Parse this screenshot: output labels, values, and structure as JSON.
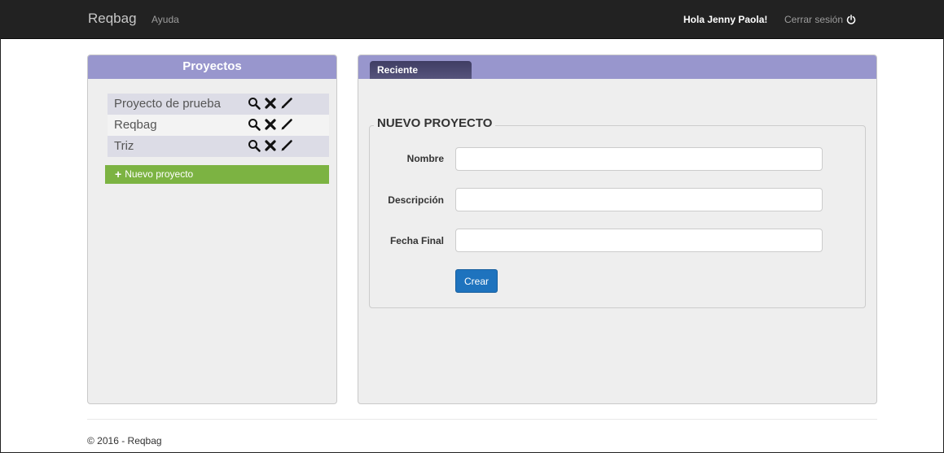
{
  "navbar": {
    "brand": "Reqbag",
    "help": "Ayuda",
    "greeting": "Hola Jenny Paola!",
    "logout": "Cerrar sesión",
    "logout_icon": "power-icon"
  },
  "sidebar": {
    "title": "Proyectos",
    "projects": [
      {
        "name": "Proyecto de prueba",
        "actions": [
          "search-icon",
          "delete-icon",
          "edit-icon"
        ]
      },
      {
        "name": "Reqbag",
        "actions": [
          "search-icon",
          "delete-icon",
          "edit-icon"
        ]
      },
      {
        "name": "Triz",
        "actions": [
          "search-icon",
          "delete-icon",
          "edit-icon"
        ]
      }
    ],
    "new_project": "Nuevo proyecto"
  },
  "main": {
    "tab": "Reciente",
    "form": {
      "legend": "NUEVO PROYECTO",
      "fields": [
        {
          "label": "Nombre",
          "value": ""
        },
        {
          "label": "Descripción",
          "value": ""
        },
        {
          "label": "Fecha Final",
          "value": ""
        }
      ],
      "submit": "Crear"
    }
  },
  "footer": {
    "text": "© 2016 - Reqbag"
  },
  "colors": {
    "navbar": "#222222",
    "panel_header": "#9896cd",
    "tab": "#3f3d63",
    "new_button": "#7cb342",
    "primary_button": "#1e73be",
    "panel_bg": "#eeeeee"
  }
}
